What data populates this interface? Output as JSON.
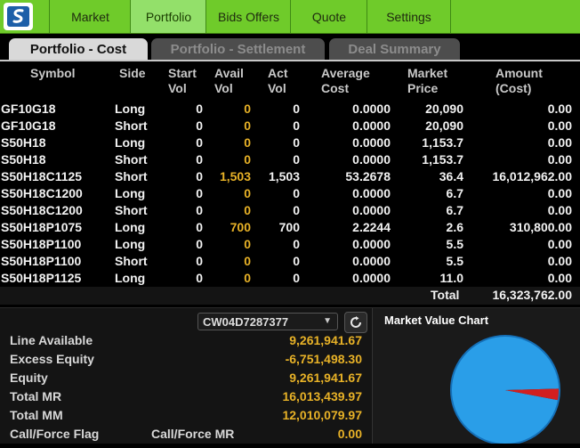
{
  "nav": {
    "items": [
      "Market",
      "Portfolio",
      "Bids Offers",
      "Quote",
      "Settings"
    ],
    "active": "Portfolio"
  },
  "tabs": [
    "Portfolio - Cost",
    "Portfolio - Settlement",
    "Deal Summary"
  ],
  "table": {
    "headers": {
      "symbol": "Symbol",
      "side": "Side",
      "start1": "Start",
      "start2": "Vol",
      "avail1": "Avail",
      "avail2": "Vol",
      "act1": "Act",
      "act2": "Vol",
      "avg1": "Average",
      "avg2": "Cost",
      "mkt1": "Market",
      "mkt2": "Price",
      "amt1": "Amount",
      "amt2": "(Cost)"
    },
    "rows": [
      {
        "symbol": "GF10G18",
        "side": "Long",
        "start": "0",
        "avail": "0",
        "act": "0",
        "avg": "0.0000",
        "price": "20,090",
        "amount": "0.00"
      },
      {
        "symbol": "GF10G18",
        "side": "Short",
        "start": "0",
        "avail": "0",
        "act": "0",
        "avg": "0.0000",
        "price": "20,090",
        "amount": "0.00"
      },
      {
        "symbol": "S50H18",
        "side": "Long",
        "start": "0",
        "avail": "0",
        "act": "0",
        "avg": "0.0000",
        "price": "1,153.7",
        "amount": "0.00"
      },
      {
        "symbol": "S50H18",
        "side": "Short",
        "start": "0",
        "avail": "0",
        "act": "0",
        "avg": "0.0000",
        "price": "1,153.7",
        "amount": "0.00"
      },
      {
        "symbol": "S50H18C1125",
        "side": "Short",
        "start": "0",
        "avail": "1,503",
        "act": "1,503",
        "avg": "53.2678",
        "price": "36.4",
        "amount": "16,012,962.00"
      },
      {
        "symbol": "S50H18C1200",
        "side": "Long",
        "start": "0",
        "avail": "0",
        "act": "0",
        "avg": "0.0000",
        "price": "6.7",
        "amount": "0.00"
      },
      {
        "symbol": "S50H18C1200",
        "side": "Short",
        "start": "0",
        "avail": "0",
        "act": "0",
        "avg": "0.0000",
        "price": "6.7",
        "amount": "0.00"
      },
      {
        "symbol": "S50H18P1075",
        "side": "Long",
        "start": "0",
        "avail": "700",
        "act": "700",
        "avg": "2.2244",
        "price": "2.6",
        "amount": "310,800.00"
      },
      {
        "symbol": "S50H18P1100",
        "side": "Long",
        "start": "0",
        "avail": "0",
        "act": "0",
        "avg": "0.0000",
        "price": "5.5",
        "amount": "0.00"
      },
      {
        "symbol": "S50H18P1100",
        "side": "Short",
        "start": "0",
        "avail": "0",
        "act": "0",
        "avg": "0.0000",
        "price": "5.5",
        "amount": "0.00"
      },
      {
        "symbol": "S50H18P1125",
        "side": "Long",
        "start": "0",
        "avail": "0",
        "act": "0",
        "avg": "0.0000",
        "price": "11.0",
        "amount": "0.00"
      }
    ],
    "total_label": "Total",
    "total_value": "16,323,762.00"
  },
  "account": {
    "selected": "CW04D7287377"
  },
  "summary": [
    {
      "label": "Line Available",
      "value": "9,261,941.67"
    },
    {
      "label": "Excess Equity",
      "value": "-6,751,498.30"
    },
    {
      "label": "Equity",
      "value": "9,261,941.67"
    },
    {
      "label": "Total MR",
      "value": "16,013,439.97"
    },
    {
      "label": "Total MM",
      "value": "12,010,079.97"
    }
  ],
  "flag": {
    "label": "Call/Force Flag",
    "mr_label": "Call/Force MR",
    "value": "0.00"
  },
  "market_value_chart": {
    "title": "Market Value Chart"
  },
  "chart_data": {
    "type": "pie",
    "title": "Market Value Chart",
    "series": [
      {
        "values": [
          96.6,
          3.4
        ],
        "colors": [
          "#2a9ee8",
          "#d21f1f"
        ]
      }
    ]
  },
  "colors": {
    "nav_green": "#6fcb2a",
    "highlight": "#e8b227",
    "pie_blue": "#2a9ee8",
    "pie_red": "#d21f1f"
  }
}
